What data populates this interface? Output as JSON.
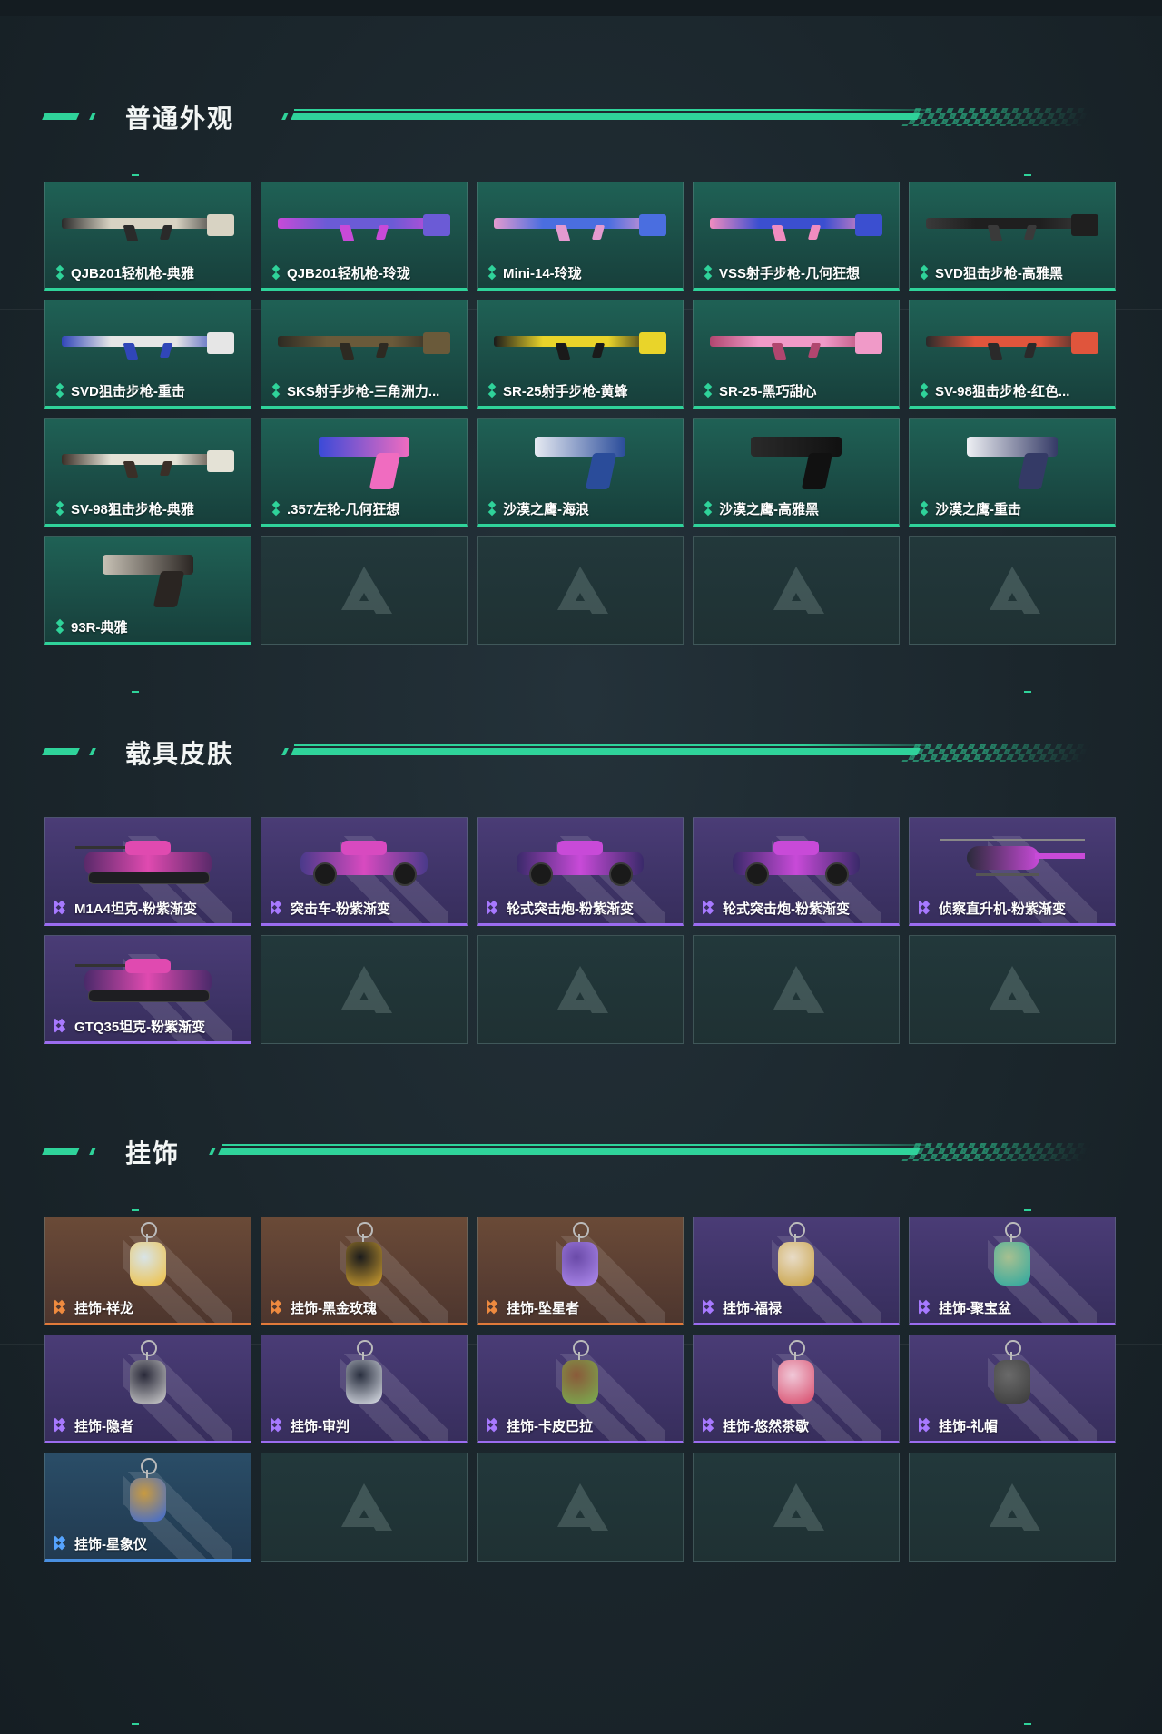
{
  "sections": {
    "weapons": {
      "title": "普通外观",
      "items": [
        {
          "label": "QJB201轻机枪-典雅"
        },
        {
          "label": "QJB201轻机枪-玲珑"
        },
        {
          "label": "Mini-14-玲珑"
        },
        {
          "label": "VSS射手步枪-几何狂想"
        },
        {
          "label": "SVD狙击步枪-高雅黑"
        },
        {
          "label": "SVD狙击步枪-重击"
        },
        {
          "label": "SKS射手步枪-三角洲力..."
        },
        {
          "label": "SR-25射手步枪-黄蜂"
        },
        {
          "label": "SR-25-黑巧甜心"
        },
        {
          "label": "SV-98狙击步枪-红色..."
        },
        {
          "label": "SV-98狙击步枪-典雅"
        },
        {
          "label": ".357左轮-几何狂想"
        },
        {
          "label": "沙漠之鹰-海浪"
        },
        {
          "label": "沙漠之鹰-高雅黑"
        },
        {
          "label": "沙漠之鹰-重击"
        },
        {
          "label": "93R-典雅"
        }
      ]
    },
    "vehicles": {
      "title": "载具皮肤",
      "items": [
        {
          "label": "M1A4坦克-粉紫渐变"
        },
        {
          "label": "突击车-粉紫渐变"
        },
        {
          "label": "轮式突击炮-粉紫渐变"
        },
        {
          "label": "轮式突击炮-粉紫渐变"
        },
        {
          "label": "侦察直升机-粉紫渐变"
        },
        {
          "label": "GTQ35坦克-粉紫渐变"
        }
      ]
    },
    "charms": {
      "title": "挂饰",
      "items": [
        {
          "label": "挂饰-祥龙"
        },
        {
          "label": "挂饰-黑金玫瑰"
        },
        {
          "label": "挂饰-坠星者"
        },
        {
          "label": "挂饰-福禄"
        },
        {
          "label": "挂饰-聚宝盆"
        },
        {
          "label": "挂饰-隐者"
        },
        {
          "label": "挂饰-审判"
        },
        {
          "label": "挂饰-卡皮巴拉"
        },
        {
          "label": "挂饰-悠然茶歇"
        },
        {
          "label": "挂饰-礼帽"
        },
        {
          "label": "挂饰-星象仪"
        }
      ]
    }
  },
  "colors": {
    "accent_green": "#2fd39a",
    "rarity_purple": "#9b6cf0",
    "rarity_orange": "#e27a3a",
    "rarity_blue": "#4a8fe0"
  }
}
